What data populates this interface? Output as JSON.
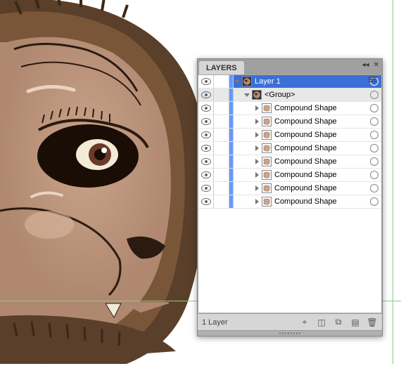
{
  "panel": {
    "tab_title": "LAYERS",
    "status": "1 Layer",
    "icons": {
      "collapse": "collapse-icon",
      "close": "close-icon",
      "menu": "menu-icon",
      "locate": "locate-icon",
      "clip": "clip-icon",
      "new_sub": "new-sublayer-icon",
      "new": "new-layer-icon",
      "trash": "trash-icon"
    }
  },
  "layers": [
    {
      "name": "Layer 1",
      "level": 0,
      "selected": true,
      "expanded": true,
      "thumb": "ape-dark",
      "has_children": true
    },
    {
      "name": "<Group>",
      "level": 1,
      "selected": false,
      "expanded": true,
      "thumb": "ape-dark",
      "has_children": true,
      "sub_selected": true
    },
    {
      "name": "Compound Shape",
      "level": 2,
      "selected": false,
      "expanded": false,
      "thumb": "shape1",
      "has_children": true
    },
    {
      "name": "Compound Shape",
      "level": 2,
      "selected": false,
      "expanded": false,
      "thumb": "shape2",
      "has_children": true
    },
    {
      "name": "Compound Shape",
      "level": 2,
      "selected": false,
      "expanded": false,
      "thumb": "shape3",
      "has_children": true
    },
    {
      "name": "Compound Shape",
      "level": 2,
      "selected": false,
      "expanded": false,
      "thumb": "shape4",
      "has_children": true
    },
    {
      "name": "Compound Shape",
      "level": 2,
      "selected": false,
      "expanded": false,
      "thumb": "shape5",
      "has_children": true
    },
    {
      "name": "Compound Shape",
      "level": 2,
      "selected": false,
      "expanded": false,
      "thumb": "shape6",
      "has_children": true
    },
    {
      "name": "Compound Shape",
      "level": 2,
      "selected": false,
      "expanded": false,
      "thumb": "shape7",
      "has_children": true
    },
    {
      "name": "Compound Shape",
      "level": 2,
      "selected": false,
      "expanded": false,
      "thumb": "shape8",
      "has_children": true
    }
  ]
}
